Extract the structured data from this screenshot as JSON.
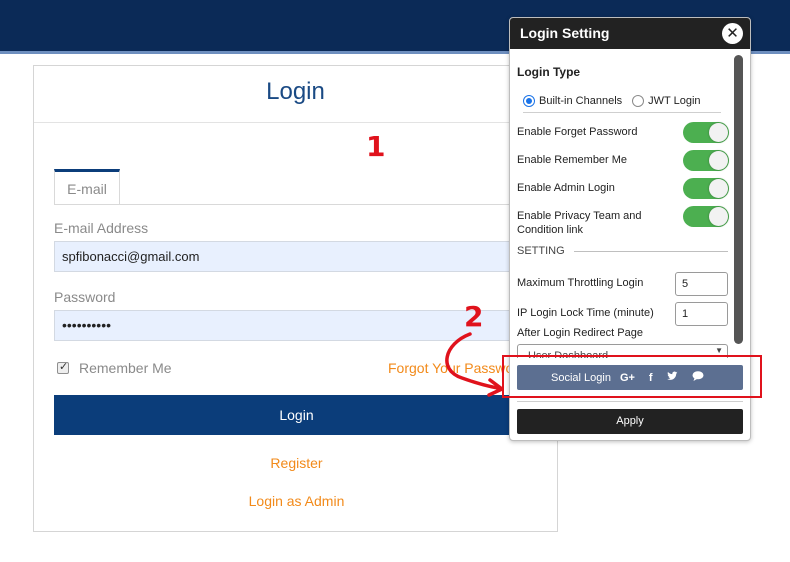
{
  "login": {
    "title": "Login",
    "tab": "E-mail",
    "email_label": "E-mail Address",
    "email_value": "spfibonacci@gmail.com",
    "password_label": "Password",
    "password_value": "••••••••••",
    "remember": "Remember Me",
    "forgot": "Forgot Your Password?",
    "login_button": "Login",
    "register": "Register",
    "admin_login": "Login as Admin"
  },
  "annotations": {
    "one": "1",
    "two": "2"
  },
  "panel": {
    "title": "Login Setting",
    "close": "✕",
    "login_type_title": "Login Type",
    "radio_builtin": "Built-in Channels",
    "radio_jwt": "JWT Login",
    "toggles": [
      "Enable Forget Password",
      "Enable Remember Me",
      "Enable Admin Login",
      "Enable Privacy Team and Condition link"
    ],
    "setting_title": "SETTING",
    "throttle_label": "Maximum Throttling Login",
    "throttle_value": "5",
    "lock_label": "IP Login Lock Time (minute)",
    "lock_value": "1",
    "redirect_label": "After Login Redirect Page",
    "redirect_value": "User Dashboard",
    "social_label": "Social Login",
    "apply": "Apply"
  },
  "icons": {
    "google": "G+",
    "facebook": "f",
    "twitter": "twitter-bird",
    "chat": "chat-bubble"
  },
  "colors": {
    "topbar": "#0b2a57",
    "primary": "#0b3d7a",
    "link": "#f28a1a",
    "toggle_on": "#4caf50",
    "annotation": "#e0121c"
  }
}
